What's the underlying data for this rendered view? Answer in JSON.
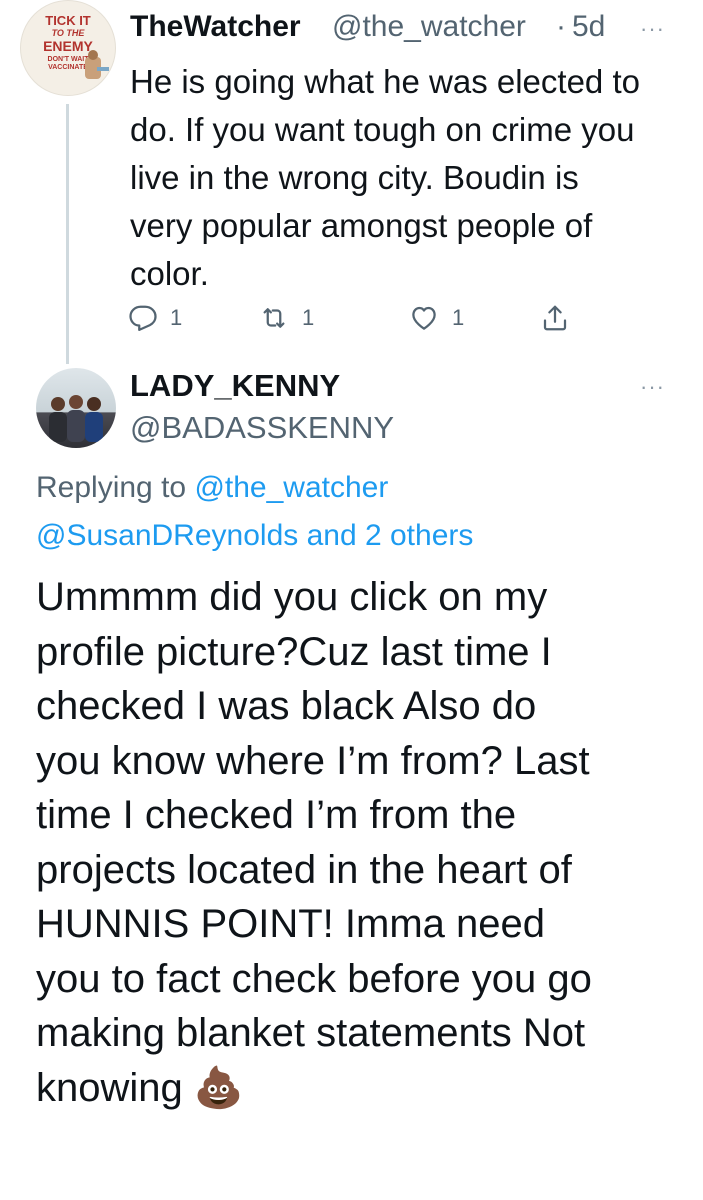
{
  "tweet1": {
    "avatar_text": [
      "TICK IT",
      "TO THE",
      "ENEMY",
      "DON'T WAIT",
      "VACCINATE"
    ],
    "display_name": "TheWatcher",
    "handle": "@the_watcher",
    "separator": "·",
    "time": "5d",
    "more": "···",
    "text": "He is going what he was elected to\ndo. If you want tough on crime you\nlive in the wrong city. Boudin is\nvery popular amongst people of\ncolor.",
    "reply_count": "1",
    "retweet_count": "1",
    "like_count": "1",
    "icons": {
      "reply": "reply-icon",
      "retweet": "retweet-icon",
      "like": "like-icon",
      "share": "share-icon"
    }
  },
  "tweet2": {
    "display_name": "LADY_KENNY",
    "handle": "@BADASSKENNY",
    "more": "···",
    "replying_prefix": "Replying to",
    "replying_to_1": "@the_watcher",
    "replying_to_2": "@SusanDReynolds and 2 others",
    "text": "Ummmm did you click on my\nprofile picture?Cuz last time I\nchecked I was black  Also do\nyou know where I’m from? Last\ntime I checked I’m from the\nprojects located in the heart  of\nHUNNIS  POINT! Imma need\nyou to fact check before you go\nmaking blanket statements  Not\nknowing 💩"
  },
  "colors": {
    "text": "#0f1419",
    "secondary": "#536471",
    "link": "#1d9bf0",
    "thread_line": "#cfd9de"
  }
}
